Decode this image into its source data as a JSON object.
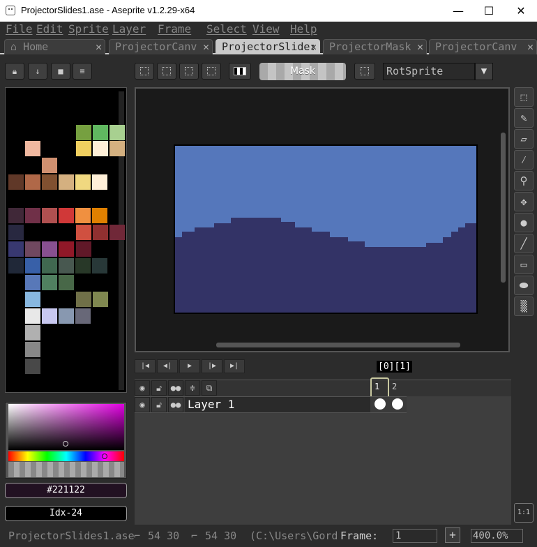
{
  "window": {
    "title": "ProjectorSlides1.ase - Aseprite v1.2.29-x64",
    "minimize": "—",
    "maximize": "☐",
    "close": "✕"
  },
  "menu": [
    "File",
    "Edit",
    "Sprite",
    "Layer",
    "Frame",
    "Select",
    "View",
    "Help"
  ],
  "tabs": [
    {
      "label": "Home",
      "icon": "home-icon",
      "close": "✕"
    },
    {
      "label": "ProjectorCanv",
      "close": "✕"
    },
    {
      "label": "ProjectorSlide:",
      "close": "✕",
      "active": true
    },
    {
      "label": "ProjectorMask",
      "close": "✕"
    },
    {
      "label": "ProjectorCanv",
      "close": "✕"
    }
  ],
  "toolbar": {
    "mask_label": "Mask",
    "rotation_algorithm": "RotSprite"
  },
  "palette": {
    "colors": [
      [
        "#76a040",
        "#60b860",
        "#a8d090"
      ],
      [
        "#f0b8a0",
        "#d09070",
        "#f0d060",
        "#fff0d8",
        "#d4b080"
      ],
      [
        "#603828",
        "#b06848",
        "#805030",
        "#d4b080",
        "#f0d880",
        "#fff0d8"
      ],
      [
        "#402838",
        "#703048",
        "#b05050",
        "#d03838",
        "#f09040",
        "#e08000"
      ],
      [
        "#282840",
        "#d05040",
        "#903030",
        "#702838"
      ],
      [
        "#383870",
        "#704860",
        "#885090",
        "#901828",
        "#601828"
      ],
      [
        "#202838",
        "#3860a8",
        "#406850",
        "#485850",
        "#283828",
        "#283838"
      ],
      [
        "#5878b8",
        "#508060",
        "#486848"
      ],
      [
        "#88b8e0",
        "#707048",
        "#808850"
      ],
      [
        "#e8e8e8",
        "#c8c8f0",
        "#8898b0",
        "#686878"
      ],
      [
        "#b0b0b0"
      ],
      [
        "#888888"
      ],
      [
        "#484848"
      ]
    ]
  },
  "color": {
    "hex": "#221122",
    "index": "Idx-24"
  },
  "timeline": {
    "frame_label": "[0][1]",
    "frames": [
      "1",
      "2"
    ],
    "layer": {
      "name": "Layer 1"
    }
  },
  "status": {
    "file": "ProjectorSlides1.ase",
    "pos": "54 30",
    "size": "54 30",
    "path": "(C:\\Users\\Gord",
    "frame_label": "Frame:",
    "frame_value": "1",
    "plus": "+",
    "zoom": "400.0%",
    "one_to_one": "1:1"
  },
  "colors": {
    "sky": "#5577bb",
    "hills": "#333366",
    "accent": "#c8c8a0"
  }
}
